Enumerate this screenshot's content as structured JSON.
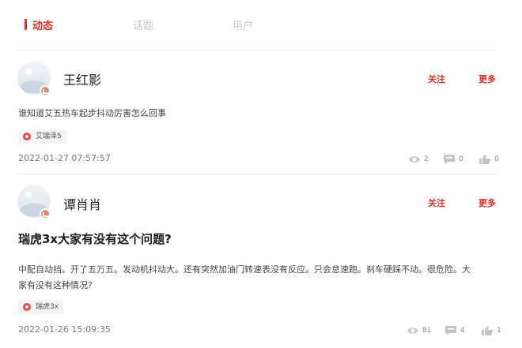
{
  "tabs": [
    {
      "label": "动态",
      "active": true
    },
    {
      "label": "话题",
      "active": false
    },
    {
      "label": "用户",
      "active": false
    }
  ],
  "accent_color": "#e02e24",
  "posts": [
    {
      "username": "王红影",
      "follow_label": "关注",
      "more_label": "更多",
      "body": "谁知道艾五热车起步抖动厉害怎么回事",
      "tag": "艾瑞泽5",
      "timestamp": "2022-01-27 07:57:57",
      "views": "2",
      "comments": "0",
      "likes": "0"
    },
    {
      "username": "谭肖肖",
      "follow_label": "关注",
      "more_label": "更多",
      "title": "瑞虎3x大家有没有这个问题?",
      "body_line1": "中配自动挡。开了五万五。发动机抖动大。还有突然加油门转速表没有反应。只会怠速跑。刹车硬踩不动。很危险。大",
      "body_line2": "家有没有这种情况?",
      "tag": "瑞虎3x",
      "timestamp": "2022-01-26 15:09:35",
      "views": "81",
      "comments": "4",
      "likes": "1"
    }
  ]
}
